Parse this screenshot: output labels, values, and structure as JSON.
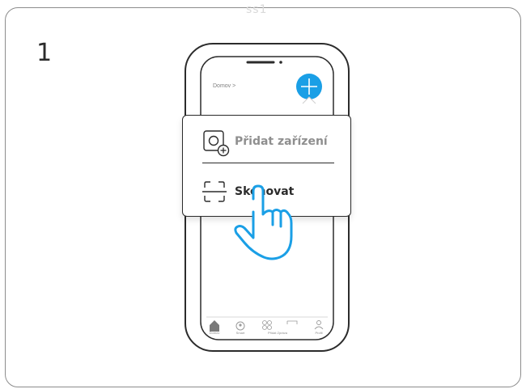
{
  "step": {
    "number": "1"
  },
  "top_fragment": "ss1",
  "phone": {
    "breadcrumb": "Domov >",
    "add_button_icon": "plus-icon",
    "accent_color": "#1a9fe6"
  },
  "popup": {
    "items": [
      {
        "label": "Přidat zařízení",
        "icon": "add-device-icon",
        "state": "inactive"
      },
      {
        "label": "Skenovat",
        "icon": "scan-frame-icon",
        "state": "active"
      }
    ]
  },
  "tab_bar": {
    "items": [
      {
        "icon": "home-icon",
        "label": "Domov"
      },
      {
        "icon": "smart-icon",
        "label": "Smart"
      },
      {
        "icon": "add-device-tab-icon",
        "label": "Přidat Zpráva"
      },
      {
        "icon": "message-icon",
        "label": ""
      },
      {
        "icon": "profile-icon",
        "label": "Profil"
      }
    ]
  },
  "gesture": {
    "icon": "pointing-hand-icon",
    "color": "#1a9fe6"
  }
}
